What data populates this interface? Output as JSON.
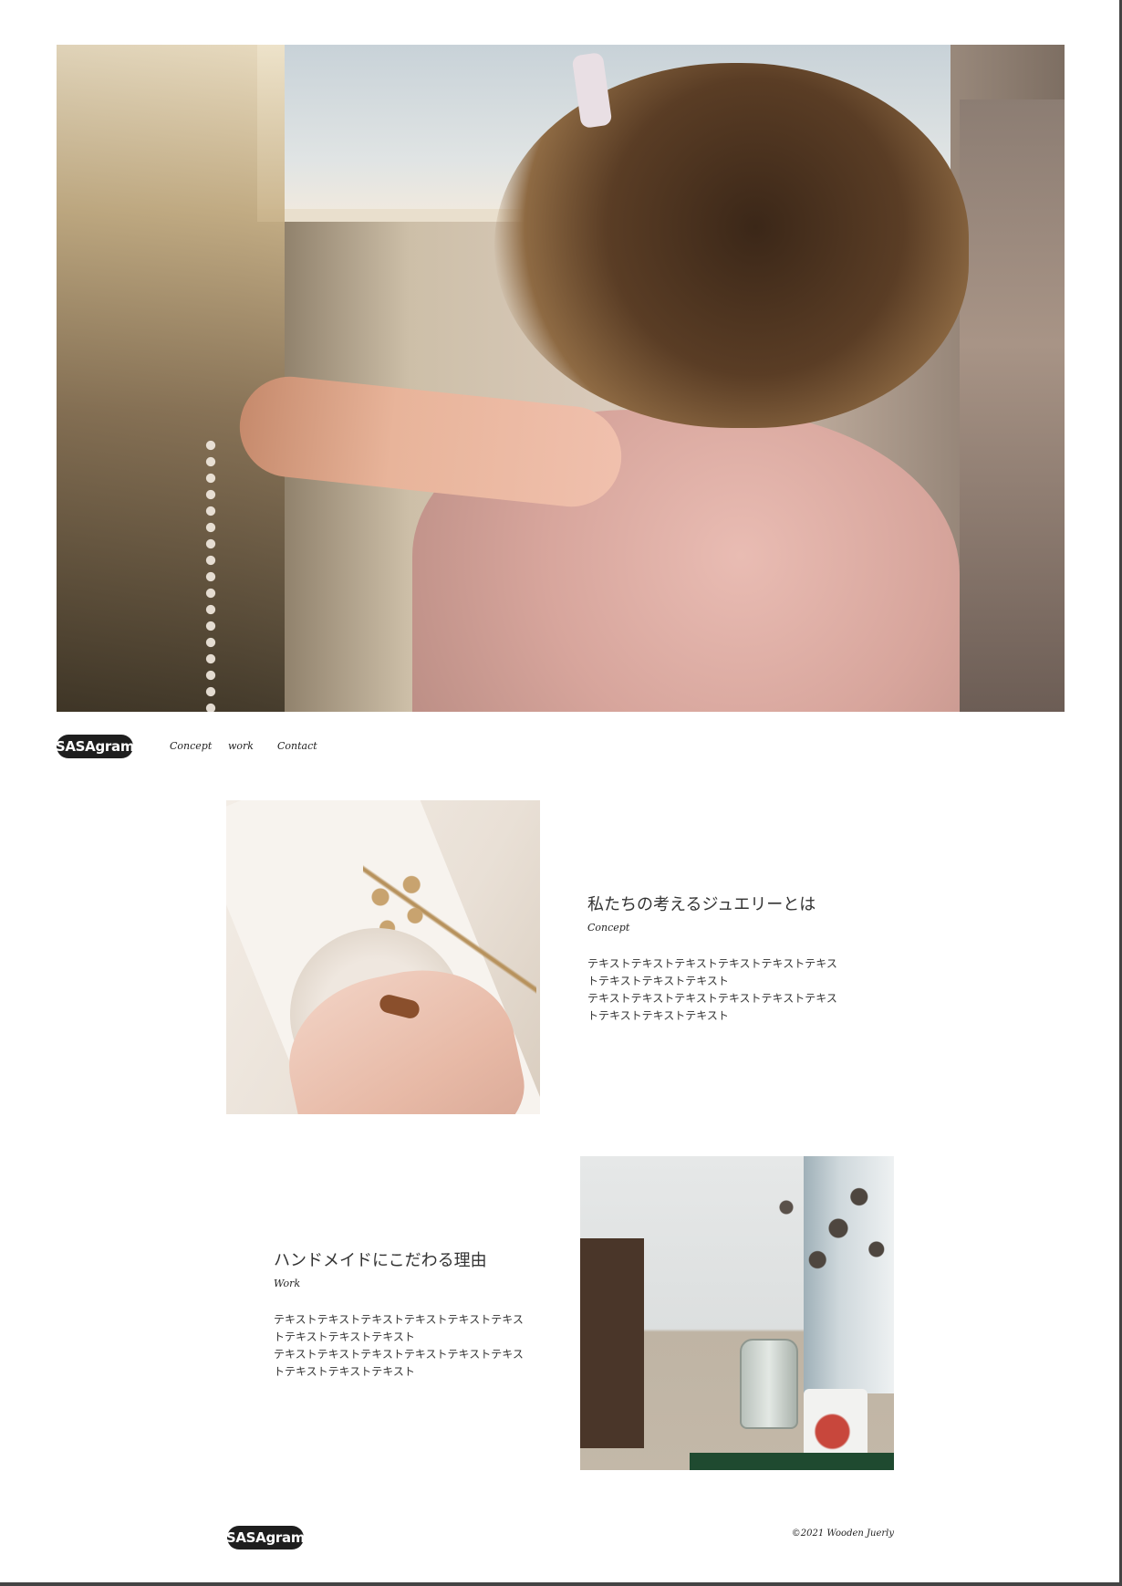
{
  "hero": {
    "image": "girl-holding-pearl-necklace"
  },
  "header": {
    "logo": "SASAgram",
    "nav": [
      {
        "label": "Concept"
      },
      {
        "label": "work"
      },
      {
        "label": "Contact"
      }
    ]
  },
  "sections": [
    {
      "image": "hand-with-wooden-ring",
      "title": "私たちの考えるジュエリーとは",
      "subtitle": "Concept",
      "body_lines": [
        "テキストテキストテキストテキストテキストテキス",
        "トテキストテキストテキスト",
        "テキストテキストテキストテキストテキストテキス",
        "トテキストテキストテキスト"
      ]
    },
    {
      "image": "workshop-table-with-dried-flowers",
      "title": "ハンドメイドにこだわる理由",
      "subtitle": "Work",
      "body_lines": [
        "テキストテキストテキストテキストテキストテキス",
        "トテキストテキストテキスト",
        "テキストテキストテキストテキストテキストテキス",
        "トテキストテキストテキスト"
      ]
    }
  ],
  "footer": {
    "logo": "SASAgram",
    "copyright": "©2021 Wooden Juerly"
  },
  "colors": {
    "text": "#333333",
    "logo_bg": "#1e1e1e",
    "logo_text": "#ffffff",
    "background": "#ffffff"
  }
}
